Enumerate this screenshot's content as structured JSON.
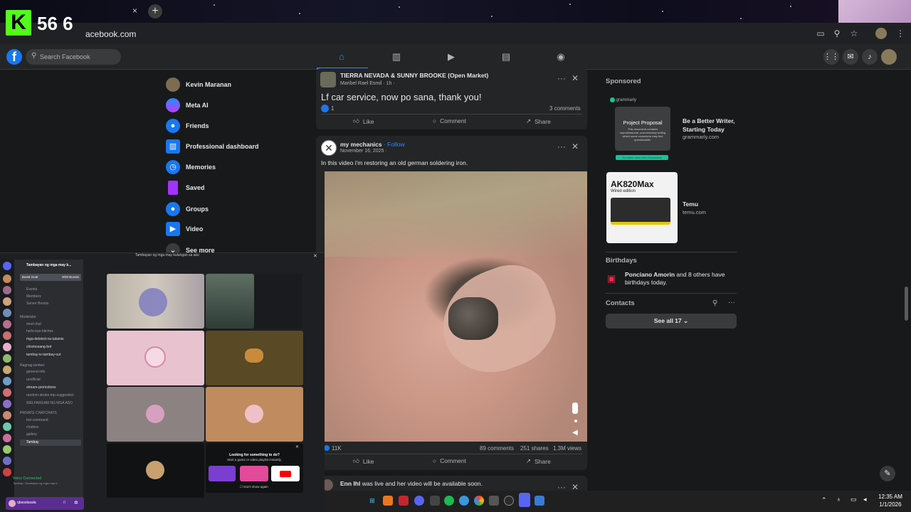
{
  "stream": {
    "logo_letter": "K",
    "viewer_count": "56 6"
  },
  "browser": {
    "url": "acebook.com",
    "tab_close": "×",
    "new_tab": "+"
  },
  "fb": {
    "search_placeholder": "Search Facebook",
    "sidebar": [
      {
        "label": "Kevin Maranan"
      },
      {
        "label": "Meta AI"
      },
      {
        "label": "Friends"
      },
      {
        "label": "Professional dashboard"
      },
      {
        "label": "Memories"
      },
      {
        "label": "Saved"
      },
      {
        "label": "Groups"
      },
      {
        "label": "Video"
      },
      {
        "label": "See more"
      }
    ],
    "post1": {
      "group": "TIERRA NEVADA & SUNNY BROOKE (Open Market)",
      "author_meta": "Maribel Rael Esmil · 1h ·",
      "text": "Lf car service, now po sana, thank you!",
      "reactions": "1",
      "comments": "3 comments",
      "like": "Like",
      "comment": "Comment",
      "share": "Share"
    },
    "post2": {
      "page": "my mechanics",
      "follow": "· Follow",
      "date": "November 16, 2025 ·",
      "text": "In this video i'm restoring an old german soldering iron.",
      "reactions": "11K",
      "comments": "89 comments",
      "shares": "251 shares",
      "views": "1.3M views",
      "like": "Like",
      "comment": "Comment",
      "share": "Share"
    },
    "post3": {
      "author": "Enn Ihl",
      "text": "was live and her video will be available soon."
    },
    "right": {
      "sponsored": "Sponsored",
      "ad1": {
        "brand": "grammarly",
        "card_title": "Project Proposal",
        "card_body": "This document contains unprofessional, unconvincing writing which some coworkers may find questionable.",
        "card_cta": "Do better work with Grammarly",
        "title1": "Be a Better Writer,",
        "title2": "Starting Today",
        "site": "grammarly.com"
      },
      "ad2": {
        "card_title": "AK820Max",
        "card_sub": "Wired edition",
        "title": "Temu",
        "site": "temu.com"
      },
      "birthdays_title": "Birthdays",
      "birthday_name": "Ponciano Amorin",
      "birthday_rest": " and 8 others have birthdays today.",
      "contacts": "Contacts",
      "see_all": "See all 17"
    }
  },
  "discord": {
    "title": "Tambayan ng mga may kulungan sa aso",
    "server_name": "Tambayan ng mga may k...",
    "boost": "Boost Goal",
    "boost_count": "9/20 Boosts",
    "channels": [
      "Events",
      "Members",
      "Server Boosts",
      "Moderator",
      "mod-chat",
      "hello-bye-bitches",
      "mga-deleted-na-talamis",
      "chismosang-bot",
      "tambay-is-tambay-out",
      "Ragnag tamber",
      "general-info",
      "unofficial",
      "stream-promotions",
      "random-stroke-trip-suggestion",
      "WELFARGAM NG MGA ASO",
      "PRIVATE CHATCHATS",
      "bot-command",
      "chatbox",
      "gallery",
      "Tambay"
    ],
    "looking_title": "Looking for something to do?",
    "looking_sub": "Start a game or video playlist instantly.",
    "dont_show": "Don't show again",
    "voice_connected": "Voice Connected",
    "voice_sub": "Tambay / Tambayan ng mga may k...",
    "user": "qbasalasala"
  },
  "taskbar": {
    "time": "12:35 AM",
    "date": "1/1/2026"
  },
  "colors": {
    "fb_blue": "#1877f2",
    "kick_green": "#53fc18",
    "bg": "#18191a",
    "card": "#242526"
  }
}
